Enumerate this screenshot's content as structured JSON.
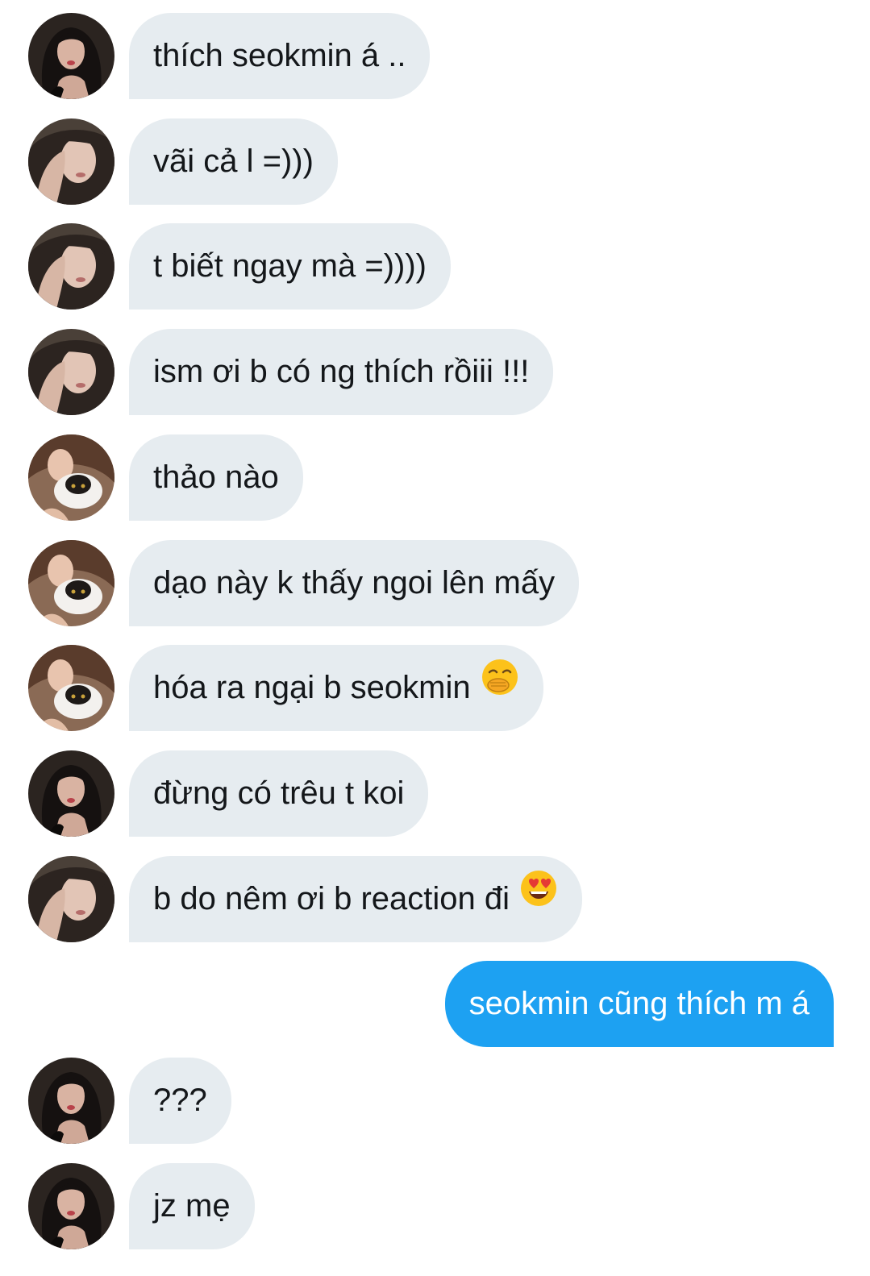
{
  "messages": [
    {
      "text": "thích seokmin á ..",
      "avatar": "avatar-dark-hair-girl",
      "emoji": ""
    },
    {
      "text": "vãi cả l =)))",
      "avatar": "avatar-hand-on-face-girl",
      "emoji": ""
    },
    {
      "text": "t biết ngay mà =))))",
      "avatar": "avatar-hand-on-face-girl",
      "emoji": ""
    },
    {
      "text": "ism ơi b có ng thích rồiii !!!",
      "avatar": "avatar-hand-on-face-girl",
      "emoji": ""
    },
    {
      "text": "thảo nào",
      "avatar": "avatar-girl-with-cat",
      "emoji": ""
    },
    {
      "text": "dạo này k thấy ngoi lên mấy",
      "avatar": "avatar-girl-with-cat",
      "emoji": ""
    },
    {
      "text": "hóa ra ngại b seokmin",
      "avatar": "avatar-girl-with-cat",
      "emoji": "face-with-hand-over-mouth-emoji"
    },
    {
      "text": "đừng có trêu t koi",
      "avatar": "avatar-dark-hair-girl",
      "emoji": ""
    },
    {
      "text": "b do nêm ơi b reaction đi",
      "avatar": "avatar-hand-on-face-girl",
      "emoji": "heart-eyes-emoji"
    },
    {
      "text": "seokmin cũng thích m á",
      "avatar": "",
      "emoji": "",
      "outgoing": true
    },
    {
      "text": "???",
      "avatar": "avatar-dark-hair-girl",
      "emoji": ""
    },
    {
      "text": "jz mẹ",
      "avatar": "avatar-dark-hair-girl",
      "emoji": ""
    }
  ],
  "colors": {
    "incoming_bubble": "#e6ecf0",
    "outgoing_bubble": "#1da1f2",
    "incoming_text": "#14171a",
    "outgoing_text": "#ffffff"
  }
}
